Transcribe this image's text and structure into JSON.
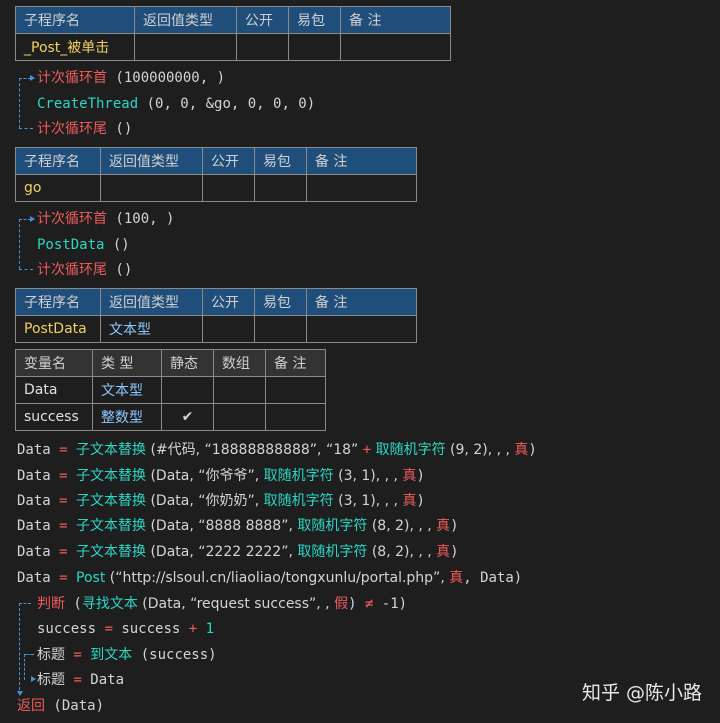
{
  "sub1": {
    "headers": [
      "子程序名",
      "返回值类型",
      "公开",
      "易包",
      "备 注"
    ],
    "row": [
      "_Post_被单击",
      "",
      "",
      "",
      ""
    ]
  },
  "loop1": {
    "start_kw": "计次循环首",
    "start_args": " (100000000, )",
    "call_fn": "CreateThread",
    "call_args": " (0, 0, &go, 0, 0, 0)",
    "end_kw": "计次循环尾",
    "end_args": " ()"
  },
  "sub2": {
    "headers": [
      "子程序名",
      "返回值类型",
      "公开",
      "易包",
      "备 注"
    ],
    "row": [
      "go",
      "",
      "",
      "",
      ""
    ]
  },
  "loop2": {
    "start_kw": "计次循环首",
    "start_args": " (100, )",
    "call_fn": "PostData",
    "call_args": " ()",
    "end_kw": "计次循环尾",
    "end_args": " ()"
  },
  "sub3": {
    "headers": [
      "子程序名",
      "返回值类型",
      "公开",
      "易包",
      "备 注"
    ],
    "row": [
      "PostData",
      "文本型",
      "",
      "",
      ""
    ]
  },
  "vars": {
    "headers": [
      "变量名",
      "类 型",
      "静态",
      "数组",
      "备 注"
    ],
    "rows": [
      {
        "name": "Data",
        "type": "文本型",
        "static": "",
        "array": "",
        "note": ""
      },
      {
        "name": "success",
        "type": "整数型",
        "static": "✔",
        "array": "",
        "note": ""
      }
    ]
  },
  "code": {
    "l1": {
      "a": "Data",
      "eq": " = ",
      "fn": "子文本替换",
      "b": " (#代码, “18888888888”, “18” ",
      "plus": "+",
      "fn2": " 取随机字符",
      "c": " (9, 2), , , ",
      "bool": "真",
      "d": ")"
    },
    "l2": {
      "a": "Data",
      "eq": " = ",
      "fn": "子文本替换",
      "b": " (Data, “你爷爷”, ",
      "fn2": "取随机字符",
      "c": " (3, 1), , , ",
      "bool": "真",
      "d": ")"
    },
    "l3": {
      "a": "Data",
      "eq": " = ",
      "fn": "子文本替换",
      "b": " (Data, “你奶奶”, ",
      "fn2": "取随机字符",
      "c": " (3, 1), , , ",
      "bool": "真",
      "d": ")"
    },
    "l4": {
      "a": "Data",
      "eq": " = ",
      "fn": "子文本替换",
      "b": " (Data, “8888 8888”, ",
      "fn2": "取随机字符",
      "c": " (8, 2), , , ",
      "bool": "真",
      "d": ")"
    },
    "l5": {
      "a": "Data",
      "eq": " = ",
      "fn": "子文本替换",
      "b": " (Data, “2222 2222”, ",
      "fn2": "取随机字符",
      "c": " (8, 2), , , ",
      "bool": "真",
      "d": ")"
    },
    "l6": {
      "a": "Data",
      "eq": " = ",
      "fn": "Post",
      "b": " (“http://slsoul.cn/liaoliao/tongxunlu/portal.php”, ",
      "bool": "真",
      "c": ", Data)"
    },
    "l7": {
      "kw": "判断",
      "b": " (",
      "fn": "寻找文本",
      "c": " (Data, “request success”, , ",
      "bool": "假",
      "d": ") ",
      "neq": "≠",
      "e": " -1)"
    },
    "l8": {
      "a": "success",
      "eq": " = ",
      "b": "success",
      "plus": " + ",
      "num": "1"
    },
    "l9": {
      "a": "标题",
      "eq": " = ",
      "fn": "到文本",
      "b": " (success)"
    },
    "l10": {
      "a": "标题",
      "eq": " = ",
      "b": "Data"
    },
    "l11": {
      "kw": "返回",
      "b": " (Data)"
    }
  },
  "watermark": "知乎 @陈小路",
  "colors": {
    "accent": "#1f4e7a",
    "keyword": "#ef5b5b",
    "function": "#2bd7c5",
    "name": "#f0d060",
    "type": "#8cc8ff",
    "guide": "#4a90d9"
  }
}
